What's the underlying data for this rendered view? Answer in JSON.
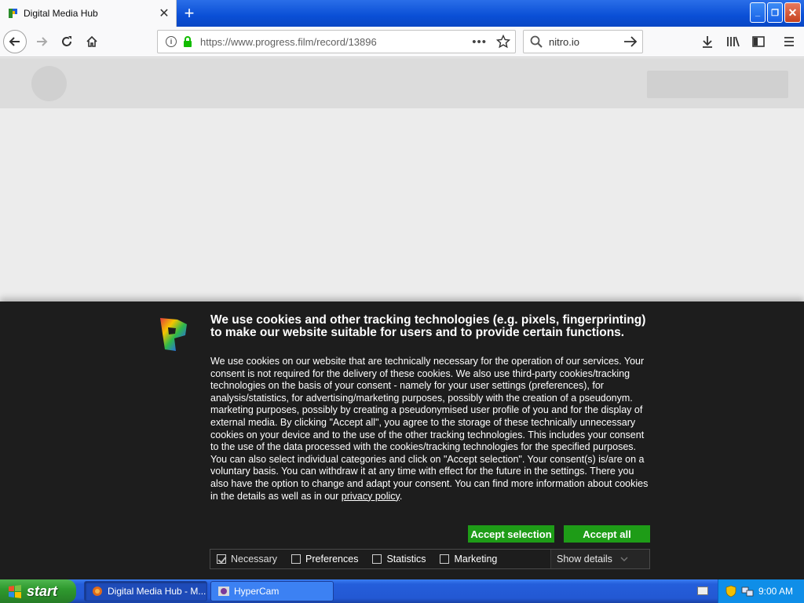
{
  "browser": {
    "tab_title": "Digital Media Hub",
    "url_host": "https://www.progress.film",
    "url_path": "/record/13896",
    "search_text": "nitro.io"
  },
  "cookie_banner": {
    "title": "We use cookies and other tracking technologies (e.g. pixels, fingerprinting) to make our website suitable for users and to provide certain functions.",
    "body": "We use cookies on our website that are technically necessary for the operation of our services. Your consent is not required for the delivery of these cookies. We also use third-party cookies/tracking technologies on the basis of your consent - namely for your user settings (preferences), for analysis/statistics, for advertising/marketing purposes, possibly with the creation of a pseudonym. marketing purposes, possibly by creating a pseudonymised user profile of you and for the display of external media. By clicking \"Accept all\", you agree to the storage of these technically unnecessary cookies on your device and to the use of the other tracking technologies. This includes your consent to the use of the data processed with the cookies/tracking technologies for the specified purposes. You can also select individual categories and click on \"Accept selection\". Your consent(s) is/are on a voluntary basis. You can withdraw it at any time with effect for the future in the settings. There you also have the option to change and adapt your consent. You can find more information about cookies in the details as well as in our ",
    "privacy_link": "privacy policy",
    "body_end": ".",
    "accept_selection": "Accept selection",
    "accept_all": "Accept all",
    "categories": [
      {
        "label": "Necessary",
        "checked": true
      },
      {
        "label": "Preferences",
        "checked": false
      },
      {
        "label": "Statistics",
        "checked": false
      },
      {
        "label": "Marketing",
        "checked": false
      }
    ],
    "show_details": "Show details"
  },
  "taskbar": {
    "start_label": "start",
    "tasks": [
      "Digital Media Hub - M...",
      "HyperCam"
    ],
    "clock": "9:00 AM"
  },
  "colors": {
    "accept_green": "#1e9c17",
    "banner_bg": "#1d1d1d",
    "xp_blue": "#245edb"
  }
}
